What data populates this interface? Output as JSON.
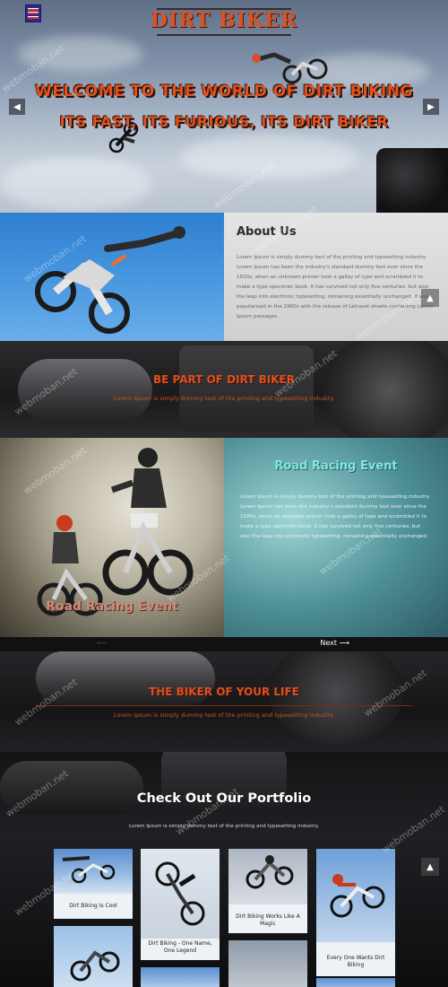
{
  "header": {
    "logo": "DIRT BIKER",
    "hero_line1": "WELCOME TO THE WORLD OF DIRT BIKING",
    "hero_line2": "ITS FAST, ITS FURIOUS, ITS DIRT BIKER",
    "prev_icon": "◀",
    "next_icon": "▶"
  },
  "about": {
    "title": "About Us",
    "text": "Lorem Ipsum is simply dummy text of the printing and typesetting industry. Lorem Ipsum has been the industry's standard dummy text ever since the 1500s, when an unknown printer took a galley of type and scrambled it to make a type specimen book. It has survived not only five centuries, but also the leap into electronic typesetting, remaining essentially unchanged. It was popularised in the 1960s with the release of Letraset sheets containing Lorem Ipsum passages.",
    "scroll_icon": "▲"
  },
  "be_part": {
    "title": "BE PART OF DIRT BIKER",
    "subtitle": "Lorem Ipsum is simply dummy text of the printing and typesetting industry."
  },
  "road_racing": {
    "title": "Road Racing Event",
    "image_caption": "Road Racing Event",
    "text": "Lorem Ipsum is simply dummy text of the printing and typesetting industry. Lorem Ipsum has been the industry's standard dummy text ever since the 1500s, when an unknown printer took a galley of type and scrambled it to make a type specimen book. It has survived not only five centuries, but also the leap into electronic typesetting, remaining essentially unchanged.",
    "next_label": "Next ⟶",
    "prev_label": "⟵"
  },
  "biker_life": {
    "title": "THE BIKER OF YOUR LIFE",
    "subtitle": "Lorem Ipsum is simply dummy text of the printing and typesetting industry."
  },
  "portfolio": {
    "title": "Check Out Our Portfolio",
    "subtitle": "Lorem Ipsum is simply dummy text of the printing and typesetting industry.",
    "arrow_icon": "▲",
    "items": [
      {
        "caption": "Dirt Biking Is Cool"
      },
      {
        "caption": "Dirt Biking - One Name, One Legend"
      },
      {
        "caption": "Dirt Biking Works Like A Magic"
      },
      {
        "caption": "Every One Wants Dirt Biking"
      }
    ]
  },
  "watermark": "webmoban.net"
}
